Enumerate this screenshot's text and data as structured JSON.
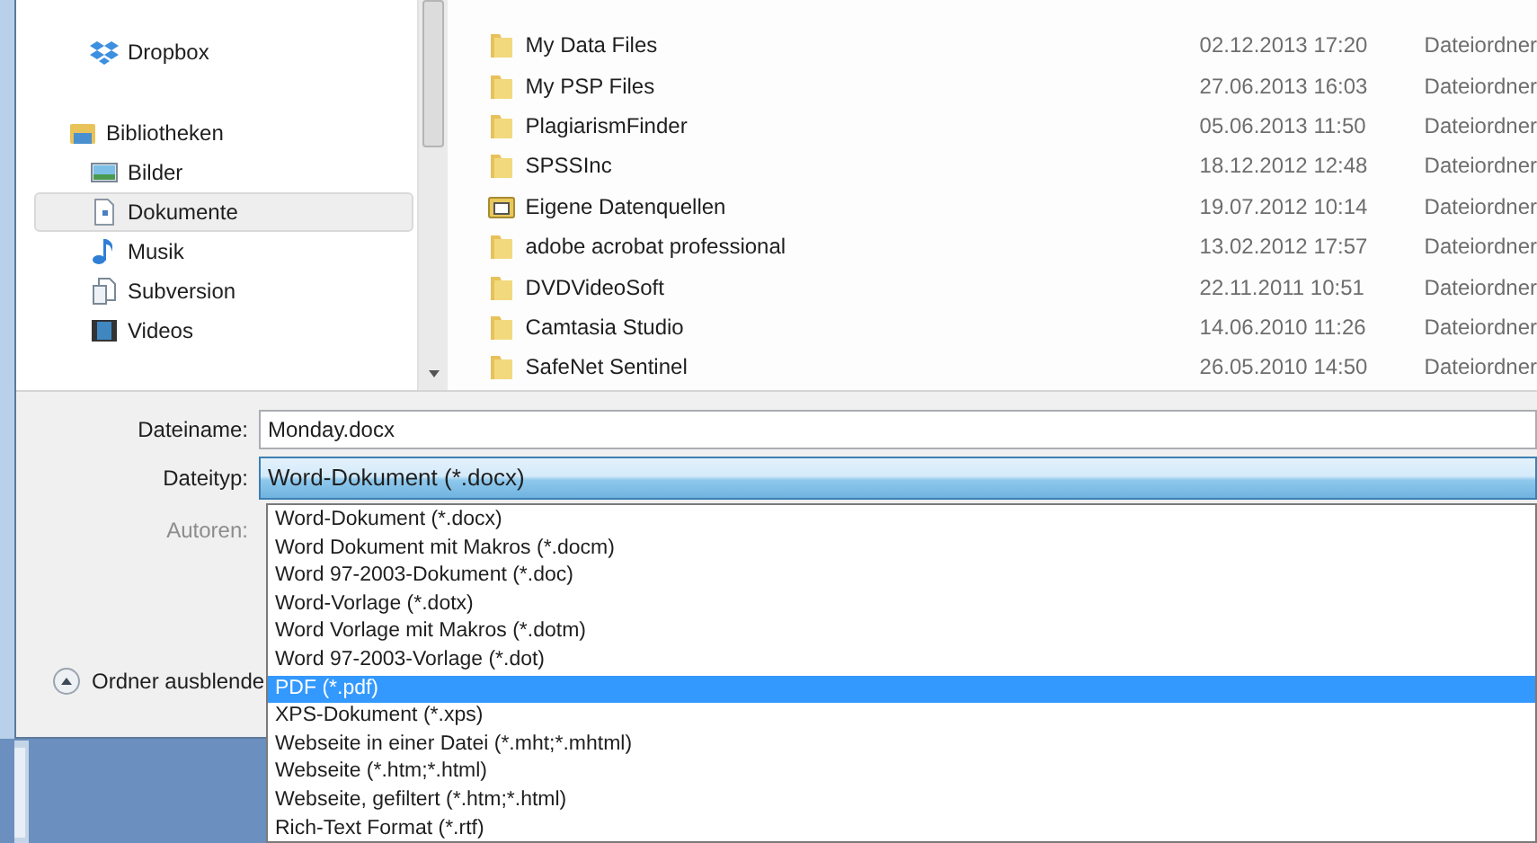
{
  "nav_pane": {
    "items": [
      {
        "label": "Dropbox",
        "kind": "dropbox",
        "selected": false
      },
      {
        "label": "Bibliotheken",
        "kind": "library",
        "selected": false
      },
      {
        "label": "Bilder",
        "kind": "pictures",
        "selected": false
      },
      {
        "label": "Dokumente",
        "kind": "documents",
        "selected": true
      },
      {
        "label": "Musik",
        "kind": "music",
        "selected": false
      },
      {
        "label": "Subversion",
        "kind": "subversion",
        "selected": false
      },
      {
        "label": "Videos",
        "kind": "videos",
        "selected": false
      }
    ]
  },
  "file_list": {
    "rows": [
      {
        "name": "My Data Files",
        "date": "02.12.2013 17:20",
        "type": "Dateiordner",
        "kind": "folder"
      },
      {
        "name": "My PSP Files",
        "date": "27.06.2013 16:03",
        "type": "Dateiordner",
        "kind": "folder"
      },
      {
        "name": "PlagiarismFinder",
        "date": "05.06.2013 11:50",
        "type": "Dateiordner",
        "kind": "folder"
      },
      {
        "name": "SPSSInc",
        "date": "18.12.2012 12:48",
        "type": "Dateiordner",
        "kind": "folder"
      },
      {
        "name": "Eigene Datenquellen",
        "date": "19.07.2012 10:14",
        "type": "Dateiordner",
        "kind": "special"
      },
      {
        "name": "adobe acrobat professional",
        "date": "13.02.2012 17:57",
        "type": "Dateiordner",
        "kind": "folder"
      },
      {
        "name": "DVDVideoSoft",
        "date": "22.11.2011 10:51",
        "type": "Dateiordner",
        "kind": "folder"
      },
      {
        "name": "Camtasia Studio",
        "date": "14.06.2010 11:26",
        "type": "Dateiordner",
        "kind": "folder"
      },
      {
        "name": "SafeNet Sentinel",
        "date": "26.05.2010 14:50",
        "type": "Dateiordner",
        "kind": "folder"
      }
    ]
  },
  "form": {
    "filename_label": "Dateiname:",
    "filename_value": "Monday.docx",
    "filetype_label": "Dateityp:",
    "filetype_value": "Word-Dokument (*.docx)",
    "authors_label": "Autoren:",
    "authors_disabled": true,
    "hide_folders_button": "Ordner ausblende"
  },
  "filetype_options": [
    {
      "label": "Word-Dokument (*.docx)",
      "selected": false
    },
    {
      "label": "Word Dokument mit Makros (*.docm)",
      "selected": false
    },
    {
      "label": "Word 97-2003-Dokument (*.doc)",
      "selected": false
    },
    {
      "label": "Word-Vorlage (*.dotx)",
      "selected": false
    },
    {
      "label": "Word Vorlage mit Makros (*.dotm)",
      "selected": false
    },
    {
      "label": "Word 97-2003-Vorlage (*.dot)",
      "selected": false
    },
    {
      "label": "PDF (*.pdf)",
      "selected": true
    },
    {
      "label": "XPS-Dokument (*.xps)",
      "selected": false
    },
    {
      "label": "Webseite in einer Datei (*.mht;*.mhtml)",
      "selected": false
    },
    {
      "label": "Webseite (*.htm;*.html)",
      "selected": false
    },
    {
      "label": "Webseite, gefiltert (*.htm;*.html)",
      "selected": false
    },
    {
      "label": "Rich-Text Format (*.rtf)",
      "selected": false
    }
  ]
}
